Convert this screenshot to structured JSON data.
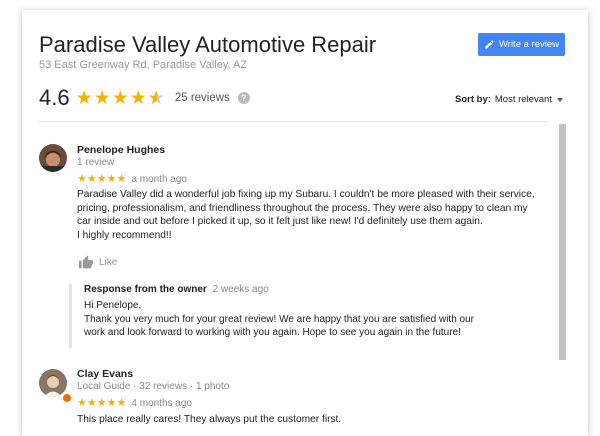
{
  "business": {
    "name": "Paradise Valley Automotive Repair",
    "address": "53 East Greenway Rd, Paradise Valley, AZ",
    "write_review_label": "Write a review",
    "rating": "4.6",
    "rating_value": 4.6,
    "reviews_count": "25 reviews",
    "help_glyph": "?"
  },
  "sort": {
    "label": "Sort by:",
    "value": "Most relevant"
  },
  "reviews": [
    {
      "name": "Penelope Hughes",
      "meta": "1 review",
      "stars": 5,
      "time": "a month ago",
      "text_lines": [
        "Paradise Valley did a wonderful job fixing up my Subaru. I couldn't be more pleased with their service,",
        "pricing, professionalism, and friendliness throughout the process. They were also happy to clean my",
        "car inside and out before I picked it up, so it felt just like new! I'd definitely use them again.",
        "I highly recommend!!"
      ],
      "like_label": "Like",
      "owner_response": {
        "title": "Response from the owner",
        "time": "2 weeks ago",
        "lines": [
          "Hi Penelope,",
          "Thank you very much for your great review! We are happy that you are satisfied with our",
          "work and look forward to working with you again. Hope to see you again in the future!"
        ]
      }
    },
    {
      "name": "Clay Evans",
      "meta": "Local Guide · 32 reviews · 1 photo",
      "stars": 5,
      "time": "4 months ago",
      "text_lines": [
        "This place really cares! They always put the customer first."
      ]
    }
  ],
  "colors": {
    "accent": "#4285f4",
    "star": "#f2b300",
    "guide_badge": "#e8710a"
  },
  "icons": [
    "pencil-icon",
    "star-icon",
    "help-icon",
    "caret-down-icon",
    "thumbs-up-icon",
    "local-guide-badge-icon"
  ]
}
